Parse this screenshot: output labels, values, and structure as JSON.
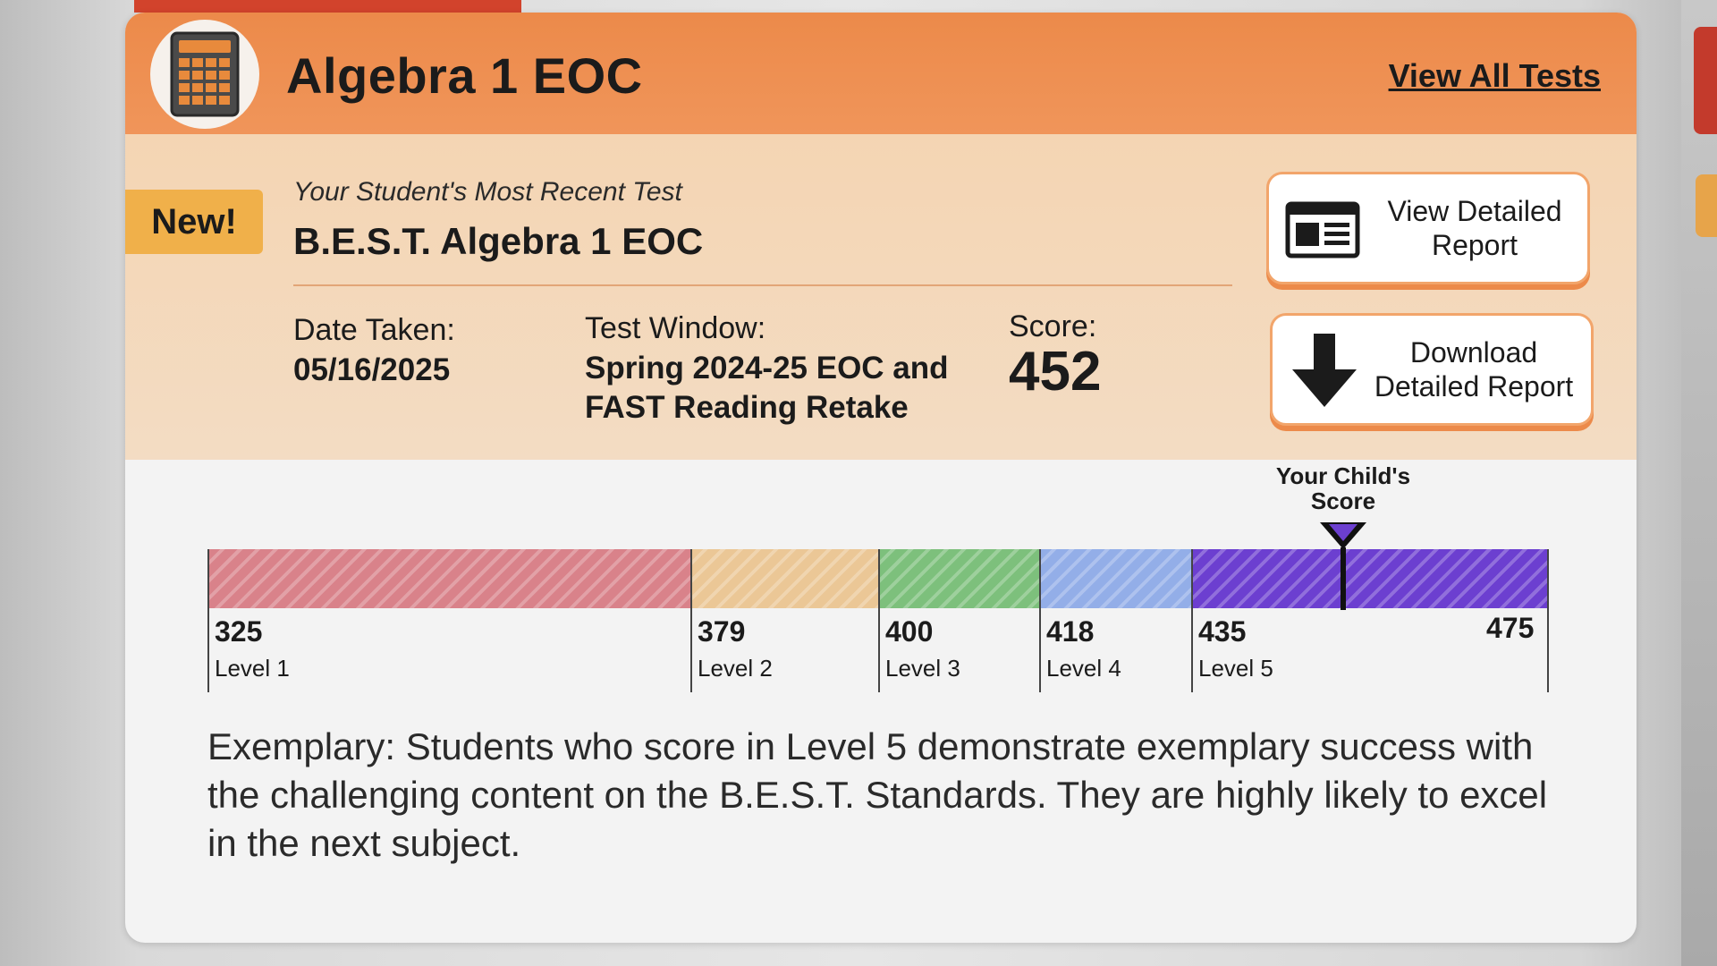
{
  "header": {
    "title": "Algebra 1 EOC",
    "view_all_label": "View All Tests",
    "icon": "calculator-icon"
  },
  "recent_test": {
    "badge": "New!",
    "caption": "Your Student's Most Recent Test",
    "name": "B.E.S.T. Algebra 1 EOC",
    "date_label": "Date Taken:",
    "date_value": "05/16/2025",
    "window_label": "Test Window:",
    "window_value_line1": "Spring 2024-25 EOC and",
    "window_value_line2": "FAST Reading Retake",
    "score_label": "Score:",
    "score_value": "452"
  },
  "actions": {
    "view_report": {
      "line1": "View Detailed",
      "line2": "Report",
      "icon": "report-icon"
    },
    "download_report": {
      "line1": "Download",
      "line2": "Detailed Report",
      "icon": "download-arrow-icon"
    }
  },
  "scale": {
    "marker_line1": "Your Child's",
    "marker_line2": "Score",
    "student_score": 452,
    "min": 325,
    "max": 475,
    "max_label": "475",
    "levels": [
      {
        "label": "Level 1",
        "start": 325,
        "start_label": "325",
        "color": "#d9828a"
      },
      {
        "label": "Level 2",
        "start": 379,
        "start_label": "379",
        "color": "#ebc796"
      },
      {
        "label": "Level 3",
        "start": 400,
        "start_label": "400",
        "color": "#7dc07c"
      },
      {
        "label": "Level 4",
        "start": 418,
        "start_label": "418",
        "color": "#93aee8"
      },
      {
        "label": "Level 5",
        "start": 435,
        "start_label": "435",
        "color": "#6c3fd0"
      }
    ]
  },
  "description": "Exemplary: Students who score in Level 5 demonstrate exemplary success with the challenging content on the B.E.S.T. Standards. They are highly likely to excel in the next subject."
}
